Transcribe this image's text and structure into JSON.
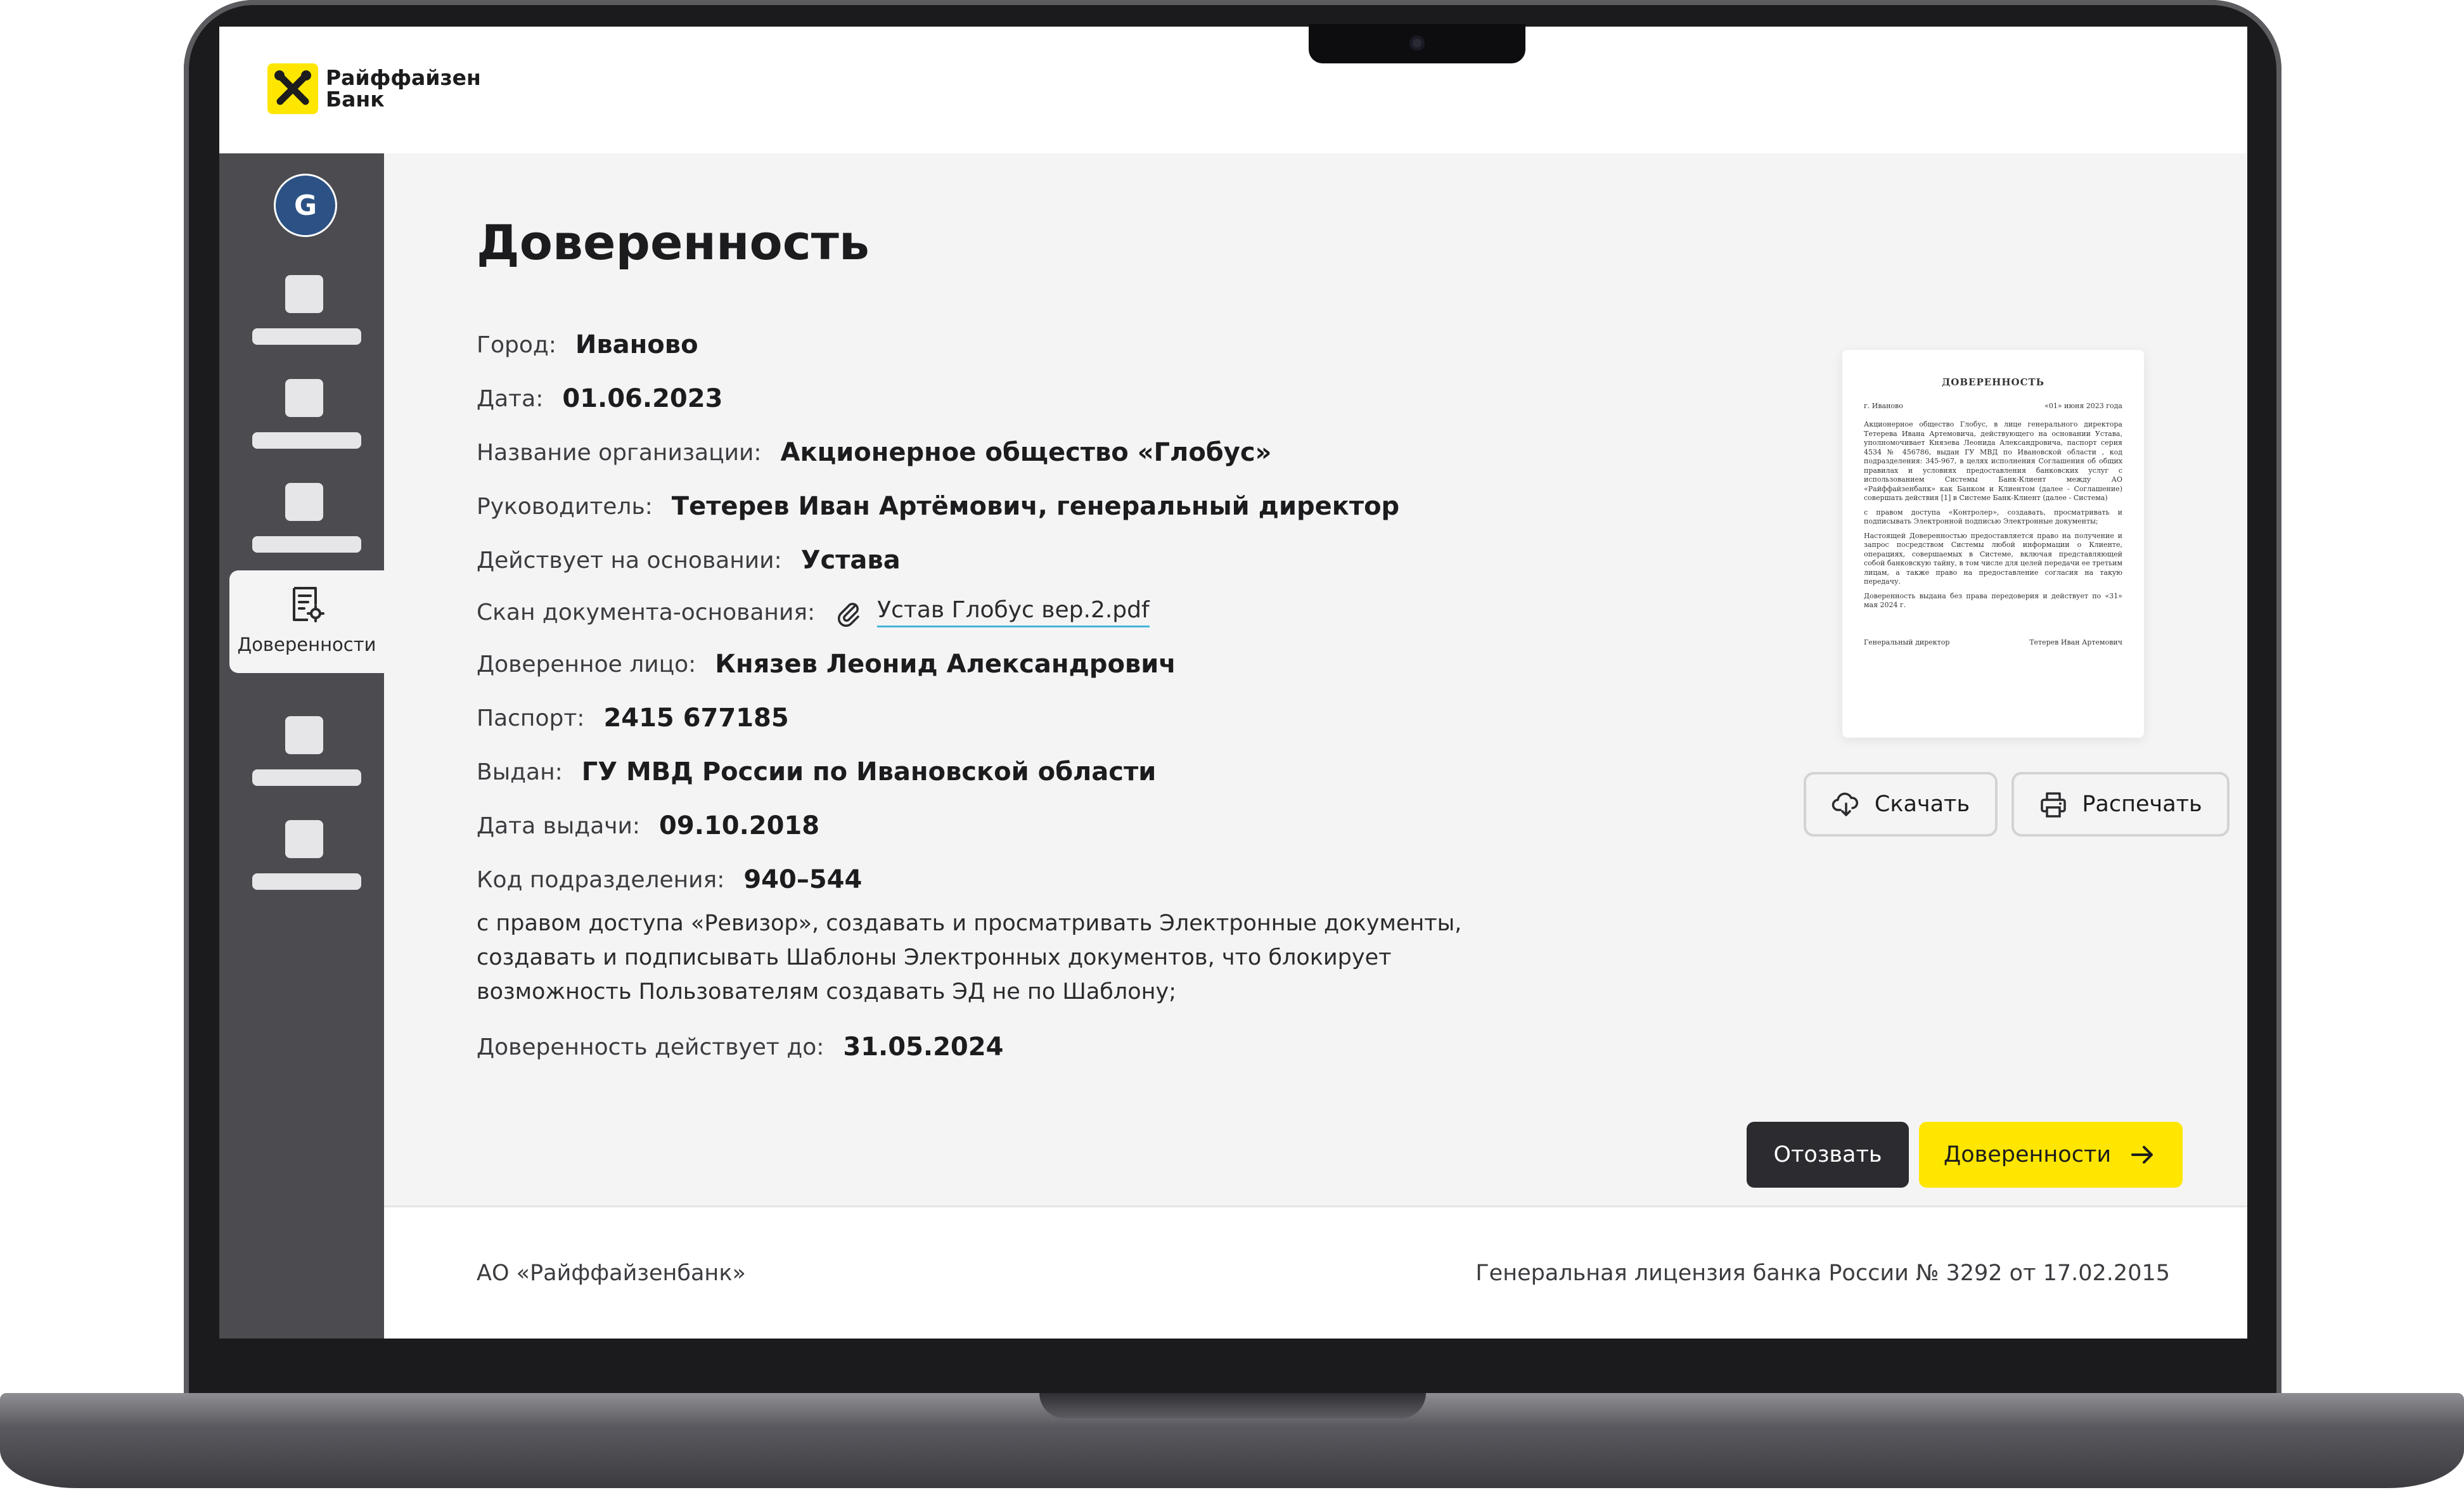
{
  "brand": {
    "name_line1": "Райффайзен",
    "name_line2": "Банк",
    "logo_color": "#fee600"
  },
  "sidebar": {
    "avatar_letter": "G",
    "active_item": {
      "label": "Доверенности",
      "icon": "document-settings-icon"
    }
  },
  "page": {
    "title": "Доверенность"
  },
  "fields": {
    "city": {
      "label": "Город:",
      "value": "Иваново"
    },
    "date": {
      "label": "Дата:",
      "value": "01.06.2023"
    },
    "org": {
      "label": "Название организации:",
      "value": "Акционерное общество «Глобус»"
    },
    "head": {
      "label": "Руководитель:",
      "value": "Тетерев Иван Артёмович, генеральный директор"
    },
    "basis": {
      "label": "Действует на основании:",
      "value": "Устава"
    },
    "scan": {
      "label": "Скан документа-основания:",
      "file": "Устав Глобус вер.2.pdf",
      "icon": "paperclip-icon"
    },
    "trustee": {
      "label": "Доверенное лицо:",
      "value": "Князев Леонид Александрович"
    },
    "passport": {
      "label": "Паспорт:",
      "value": "2415 677185"
    },
    "issued_by": {
      "label": "Выдан:",
      "value": "ГУ МВД России по Ивановской области"
    },
    "issue_date": {
      "label": "Дата выдачи:",
      "value": "09.10.2018"
    },
    "division_code": {
      "label": "Код подразделения:",
      "value": "940–544"
    },
    "rights": "с правом доступа «Ревизор», создавать и просматривать Электронные документы, создавать и подписывать Шаблоны Электронных документов, что блокирует возможность Пользователям создавать ЭД не по Шаблону;",
    "valid_until": {
      "label": "Доверенность действует до:",
      "value": "31.05.2024"
    }
  },
  "preview": {
    "title": "ДОВЕРЕННОСТЬ",
    "city": "г. Иваново",
    "date": "«01» июня 2023 года",
    "p1": "Акционерное общество Глобус, в лице генерального директора Тетерева Ивана Артемовича, действующего на основании Устава, уполномочивает Князева Леонида Александровича, паспорт серия 4534 № 456786, выдан ГУ МВД по Ивановской области , код подразделения: 345-967, в целях исполнения Соглашения об общих правилах и условиях предоставления банковских услуг с использованием Системы Банк-Клиент между АО «Райффайзенбанк» как Банком и Клиентом (далее - Соглашение) совершать действия [1] в Системе Банк-Клиент (далее - Система)",
    "p2": "с правом доступа «Контролер», создавать, просматривать и подписывать Электронной подписью Электронные документы;",
    "p3": "Настоящей Доверенностью предоставляется право на получение и запрос посредством Системы любой информации о Клиенте, операциях, совершаемых в Системе, включая представляющей собой банковскую тайну, в том числе для целей передачи ее третьим лицам, а также право на предоставление согласия на такую передачу.",
    "p4": "Доверенность выдана без права передоверия и действует по «31» мая 2024 г.",
    "sign_role": "Генеральный директор",
    "sign_name": "Тетерев Иван Артемович"
  },
  "actions": {
    "download": {
      "label": "Скачать",
      "icon": "cloud-download-icon"
    },
    "print": {
      "label": "Распечать",
      "icon": "printer-icon"
    },
    "revoke": {
      "label": "Отозвать"
    },
    "to_list": {
      "label": "Доверенности",
      "icon": "arrow-right-icon"
    }
  },
  "footer": {
    "company": "АО «Райффайзенбанк»",
    "license": "Генеральная лицензия банка России № 3292 от 17.02.2015"
  }
}
